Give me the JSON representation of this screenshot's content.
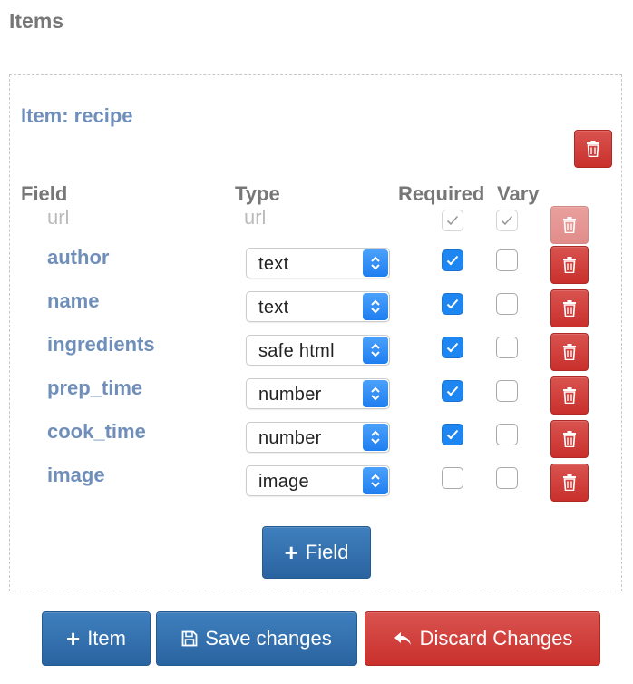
{
  "page": {
    "title": "Items"
  },
  "item": {
    "title": "Item: recipe",
    "headers": {
      "field": "Field",
      "type": "Type",
      "required": "Required",
      "vary": "Vary"
    },
    "fields": [
      {
        "name": "author",
        "type": "text",
        "required": true,
        "vary": false
      },
      {
        "name": "name",
        "type": "text",
        "required": true,
        "vary": false
      },
      {
        "name": "ingredients",
        "type": "safe html",
        "required": true,
        "vary": false
      },
      {
        "name": "prep_time",
        "type": "number",
        "required": true,
        "vary": false
      },
      {
        "name": "cook_time",
        "type": "number",
        "required": true,
        "vary": false
      },
      {
        "name": "image",
        "type": "image",
        "required": false,
        "vary": false
      }
    ],
    "url_field": {
      "name": "url",
      "type": "url",
      "required": true,
      "vary": true
    },
    "add_field_label": "Field"
  },
  "footer": {
    "add_item_label": "Item",
    "save_label": "Save changes",
    "discard_label": "Discard Changes"
  },
  "colors": {
    "primary": "#2a64a0",
    "danger": "#c9302c",
    "field_name": "#6f8fba",
    "checkbox_checked": "#1e86f0"
  },
  "icons": {
    "delete": "trash-icon",
    "select": "chevron-updown-icon",
    "check": "check-icon",
    "add": "plus-icon",
    "save": "floppy-disk-icon",
    "discard": "undo-arrow-icon"
  }
}
